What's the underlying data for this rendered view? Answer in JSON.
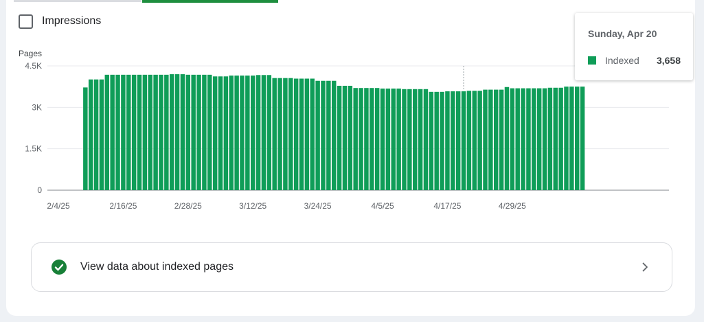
{
  "legend": {
    "checkbox_label": "Impressions"
  },
  "tooltip": {
    "date": "Sunday, Apr 20",
    "series": "Indexed",
    "value": "3,658"
  },
  "link_card": {
    "label": "View data about indexed pages"
  },
  "colors": {
    "bar": "#0f9d58",
    "accent_tab": "#1e8e3e",
    "check": "#188038"
  },
  "chart_data": {
    "type": "bar",
    "ylabel": "Pages",
    "ylim": [
      0,
      4500
    ],
    "yticks": [
      0,
      1500,
      3000,
      4500
    ],
    "ytick_labels": [
      "0",
      "1.5K",
      "3K",
      "4.5K"
    ],
    "x_tick_labels": [
      "2/4/25",
      "2/16/25",
      "2/28/25",
      "3/12/25",
      "3/24/25",
      "4/5/25",
      "4/17/25",
      "4/29/25"
    ],
    "x_start": "2/4/25",
    "x_end": "5/2/25",
    "grid": true,
    "series": [
      {
        "name": "Indexed",
        "x_start": "2/9/25",
        "values": [
          3720,
          4010,
          4010,
          4010,
          4180,
          4180,
          4180,
          4180,
          4180,
          4180,
          4180,
          4180,
          4180,
          4180,
          4180,
          4180,
          4200,
          4200,
          4200,
          4180,
          4180,
          4180,
          4180,
          4180,
          4120,
          4120,
          4120,
          4150,
          4150,
          4150,
          4150,
          4150,
          4170,
          4170,
          4170,
          4060,
          4060,
          4060,
          4060,
          4040,
          4040,
          4040,
          4040,
          3960,
          3960,
          3960,
          3960,
          3780,
          3780,
          3780,
          3700,
          3700,
          3700,
          3700,
          3700,
          3680,
          3680,
          3680,
          3680,
          3660,
          3660,
          3660,
          3660,
          3660,
          3560,
          3560,
          3560,
          3580,
          3580,
          3580,
          3580,
          3600,
          3600,
          3600,
          3640,
          3640,
          3640,
          3640,
          3735,
          3690,
          3690,
          3690,
          3690,
          3690,
          3690,
          3690,
          3710,
          3710,
          3710,
          3750,
          3750,
          3750,
          3750
        ]
      }
    ],
    "highlighted": {
      "date": "4/20/25",
      "value": 3658
    }
  }
}
